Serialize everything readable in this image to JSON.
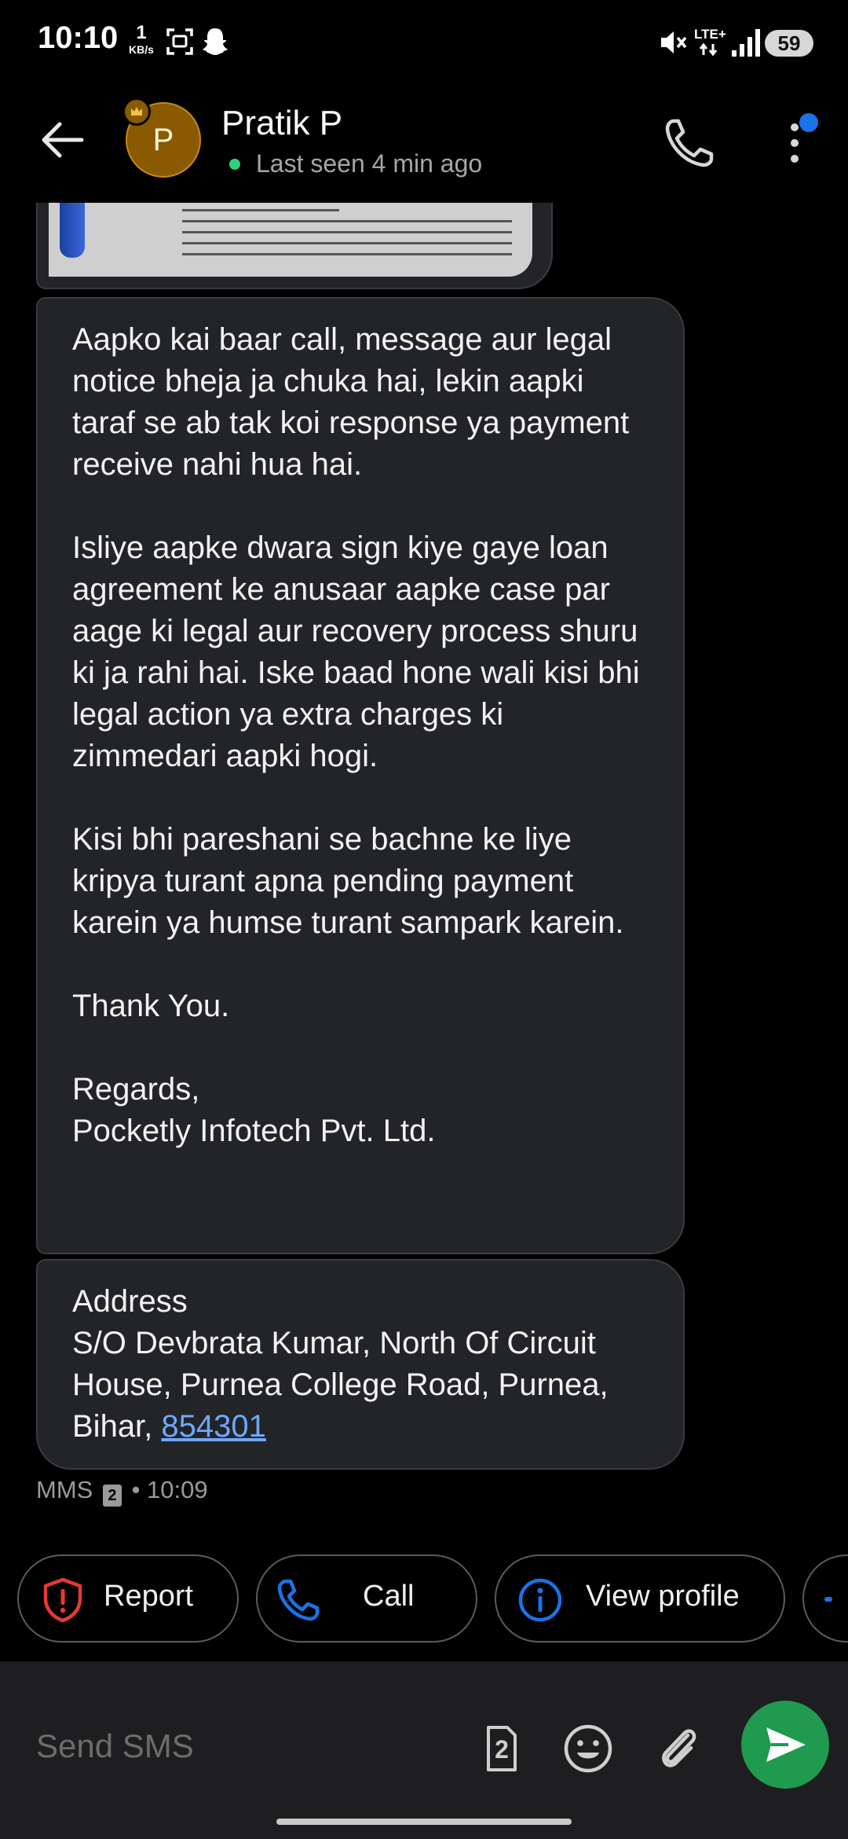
{
  "status_bar": {
    "time": "10:10",
    "net_speed_value": "1",
    "net_speed_unit": "KB/s",
    "network_label": "LTE+",
    "battery": "59"
  },
  "header": {
    "contact_name": "Pratik P",
    "avatar_initial": "P",
    "last_seen": "Last seen 4 min ago"
  },
  "messages": {
    "body_1": "Aapko kai baar call, message aur legal notice bheja ja chuka hai, lekin aapki taraf se ab tak koi response ya payment receive nahi hua hai.\n\nIsliye aapke dwara sign kiye gaye loan agreement ke anusaar aapke case par aage ki legal aur recovery process shuru ki ja rahi hai. Iske baad hone wali kisi bhi legal action ya extra charges ki zimmedari aapki hogi.\n\nKisi bhi pareshani se bachne ke liye kripya turant apna pending payment karein ya humse turant sampark karein.\n\nThank You.\n\nRegards,\nPocketly Infotech Pvt. Ltd.",
    "body_2_text": "Address\nS/O Devbrata Kumar, North Of Circuit House, Purnea College Road, Purnea, Bihar, ",
    "body_2_link": "854301",
    "meta_type": "MMS",
    "meta_sim": "2",
    "meta_time": "• 10:09"
  },
  "chips": {
    "report": "Report",
    "call": "Call",
    "view_profile": "View profile"
  },
  "compose": {
    "placeholder": "Send SMS",
    "sim_number": "2"
  },
  "colors": {
    "accent_blue": "#1a73e8",
    "send_green": "#1f9a4e",
    "report_red": "#e53935",
    "online_green": "#2fd17a"
  }
}
